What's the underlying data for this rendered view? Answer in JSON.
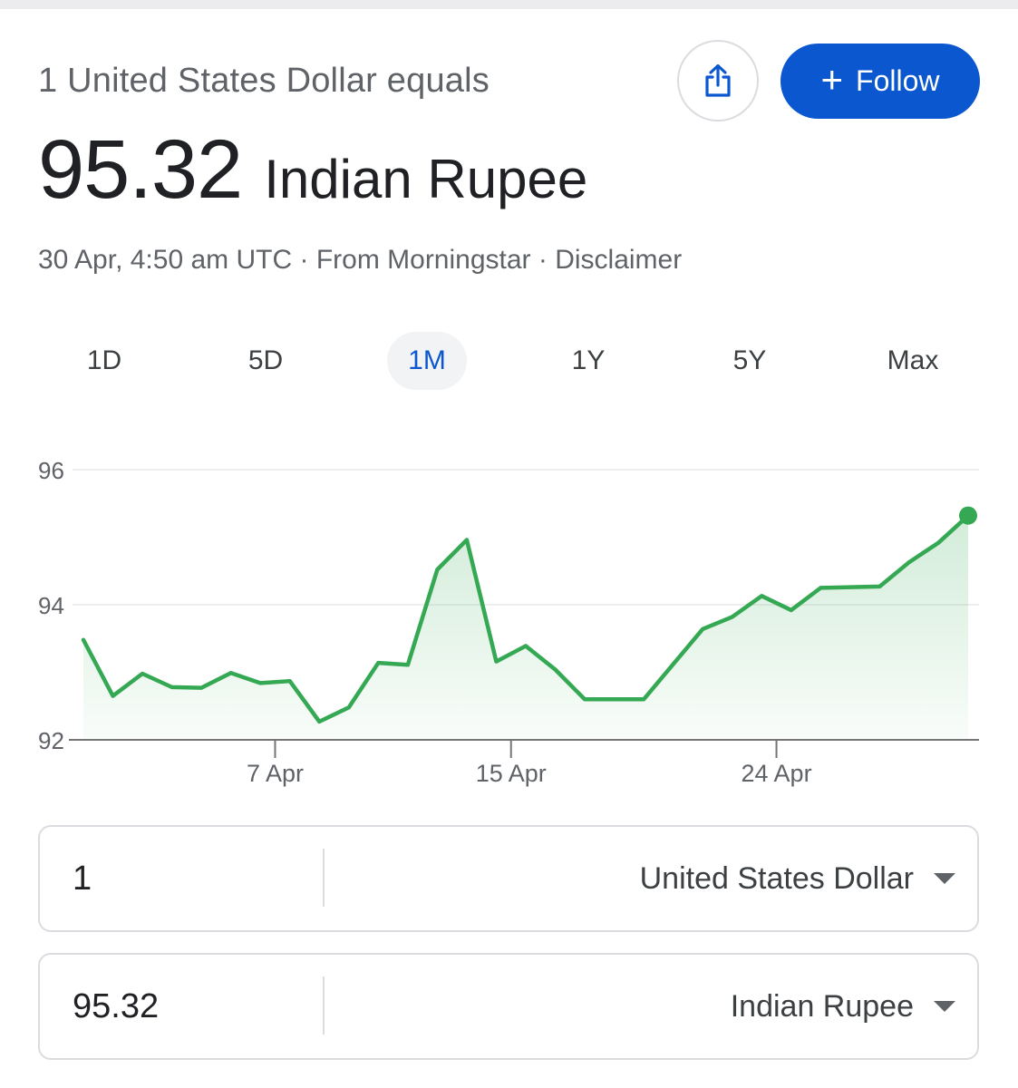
{
  "header": {
    "subtitle": "1 United States Dollar equals",
    "rate_value": "95.32",
    "rate_unit": "Indian Rupee",
    "timestamp": "30 Apr, 4:50 am UTC",
    "separator": " · ",
    "source": "From Morningstar",
    "disclaimer": "Disclaimer",
    "follow_label": "Follow",
    "follow_plus": "+"
  },
  "ranges": {
    "items": [
      "1D",
      "5D",
      "1M",
      "1Y",
      "5Y",
      "Max"
    ],
    "selected": "1M"
  },
  "colors": {
    "line": "#34a853",
    "accent": "#0b57d0",
    "muted_text": "#5f6368"
  },
  "chart_data": {
    "type": "area",
    "x": [
      "1 Apr",
      "2 Apr",
      "3 Apr",
      "4 Apr",
      "5 Apr",
      "6 Apr",
      "7 Apr",
      "8 Apr",
      "9 Apr",
      "10 Apr",
      "11 Apr",
      "12 Apr",
      "13 Apr",
      "14 Apr",
      "15 Apr",
      "16 Apr",
      "17 Apr",
      "18 Apr",
      "19 Apr",
      "20 Apr",
      "21 Apr",
      "22 Apr",
      "23 Apr",
      "24 Apr",
      "25 Apr",
      "26 Apr",
      "27 Apr",
      "28 Apr",
      "29 Apr",
      "30 Apr"
    ],
    "values": [
      93.48,
      92.65,
      92.98,
      92.78,
      92.77,
      92.99,
      92.84,
      92.87,
      92.27,
      92.48,
      93.14,
      93.11,
      94.52,
      94.96,
      93.16,
      93.39,
      93.04,
      92.6,
      92.6,
      92.6,
      93.12,
      93.64,
      93.82,
      94.13,
      93.92,
      94.25,
      94.26,
      94.27,
      94.63,
      94.92,
      95.32
    ],
    "ylim": [
      92,
      96
    ],
    "y_ticks": [
      96,
      94,
      92
    ],
    "x_ticks": [
      {
        "label": "7 Apr",
        "index": 6.5
      },
      {
        "label": "15 Apr",
        "index": 14.5
      },
      {
        "label": "24 Apr",
        "index": 23.5
      }
    ],
    "grid": true,
    "title": "",
    "xlabel": "",
    "ylabel": ""
  },
  "converter": [
    {
      "amount": "1",
      "currency": "United States Dollar"
    },
    {
      "amount": "95.32",
      "currency": "Indian Rupee"
    }
  ]
}
